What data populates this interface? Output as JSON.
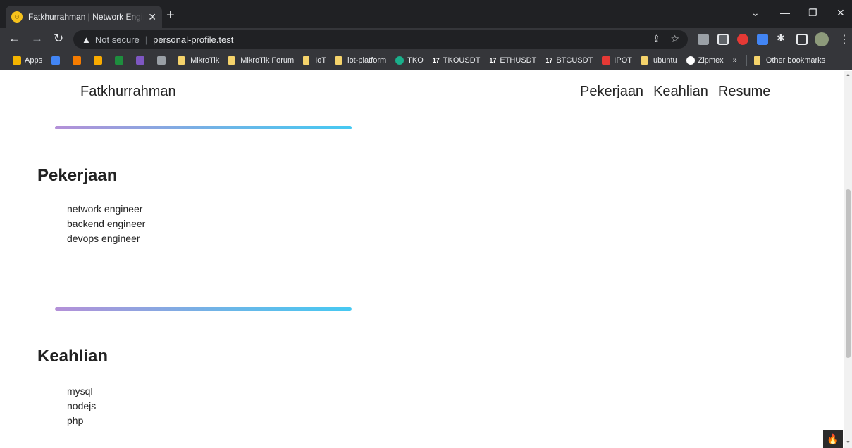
{
  "browser": {
    "tab_title": "Fatkhurrahman | Network Engineer",
    "tab_close": "✕",
    "new_tab": "+",
    "not_secure": "Not secure",
    "url": "personal-profile.test",
    "bookmarks": [
      {
        "label": "Apps",
        "icon": "apps-grid-icon",
        "color": "#f4b400"
      },
      {
        "label": "",
        "icon": "docs-icon",
        "color": "#4285f4"
      },
      {
        "label": "",
        "icon": "blogger-icon",
        "color": "#f57c00"
      },
      {
        "label": "",
        "icon": "analytics-icon",
        "color": "#f9ab00"
      },
      {
        "label": "",
        "icon": "w-icon",
        "color": "#1e8e3e"
      },
      {
        "label": "",
        "icon": "b-icon",
        "color": "#7e57c2"
      },
      {
        "label": "",
        "icon": "car-icon",
        "color": "#9aa0a6"
      },
      {
        "label": "MikroTik",
        "icon": "folder-icon",
        "color": "#f5d36b"
      },
      {
        "label": "MikroTik Forum",
        "icon": "folder-icon",
        "color": "#f5d36b"
      },
      {
        "label": "IoT",
        "icon": "folder-icon",
        "color": "#f5d36b"
      },
      {
        "label": "iot-platform",
        "icon": "folder-icon",
        "color": "#f5d36b"
      },
      {
        "label": "TKO",
        "icon": "tko-icon",
        "color": "#1aaf8b"
      },
      {
        "label": "TKOUSDT",
        "icon": "tradingview-icon",
        "color": "#ffffff"
      },
      {
        "label": "ETHUSDT",
        "icon": "tradingview-icon",
        "color": "#ffffff"
      },
      {
        "label": "BTCUSDT",
        "icon": "tradingview-icon",
        "color": "#ffffff"
      },
      {
        "label": "IPOT",
        "icon": "ipot-icon",
        "color": "#e53935"
      },
      {
        "label": "ubuntu",
        "icon": "folder-icon",
        "color": "#f5d36b"
      },
      {
        "label": "Zipmex",
        "icon": "zipmex-icon",
        "color": "#ffffff"
      }
    ],
    "more_bookmarks": "»",
    "other_bookmarks": "Other bookmarks"
  },
  "page": {
    "brand": "Fatkhurrahman",
    "nav": [
      "Pekerjaan",
      "Keahlian",
      "Resume"
    ],
    "sections": [
      {
        "title": "Pekerjaan",
        "items": [
          "network engineer",
          "backend engineer",
          "devops engineer"
        ]
      },
      {
        "title": "Keahlian",
        "items": [
          "mysql",
          "nodejs",
          "php"
        ]
      }
    ]
  },
  "colors": {
    "divider_start": "#b490d8",
    "divider_end": "#46c9f2"
  }
}
